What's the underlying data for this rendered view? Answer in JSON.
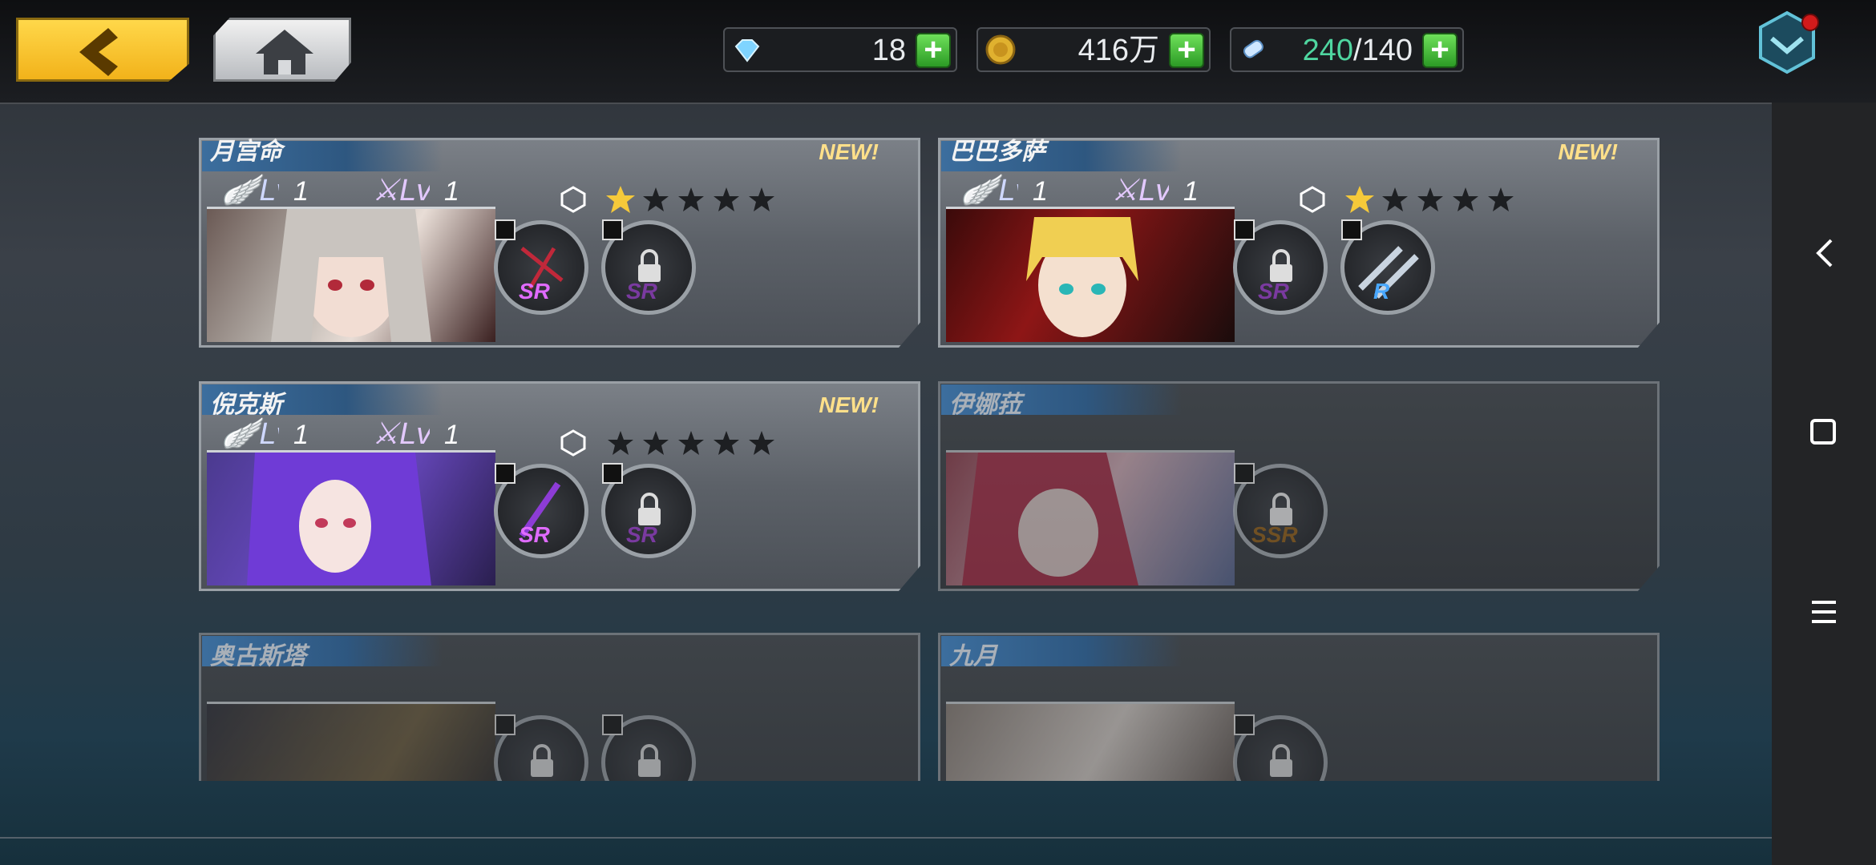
{
  "header": {
    "resources": [
      {
        "name": "diamond",
        "icon": "diamond-icon",
        "value": "18"
      },
      {
        "name": "gold",
        "icon": "gold-coin-icon",
        "value": "416万"
      },
      {
        "name": "stamina",
        "icon": "stamina-potion-icon",
        "current": "240",
        "max_sep": "/140"
      }
    ]
  },
  "side_nav": {
    "back": "‹",
    "home": "□",
    "menu": "≡"
  },
  "new_label": "NEW!",
  "cards": [
    {
      "name": "月宫命",
      "new": true,
      "lv1": "1",
      "lv2": "1",
      "stars": 1,
      "locked": false,
      "weapons": [
        {
          "rarity": "SR",
          "locked": false
        },
        {
          "rarity": "SR",
          "locked": true
        }
      ]
    },
    {
      "name": "巴巴多萨",
      "new": true,
      "lv1": "1",
      "lv2": "1",
      "stars": 1,
      "locked": false,
      "weapons": [
        {
          "rarity": "SR",
          "locked": true
        },
        {
          "rarity": "R",
          "locked": false
        }
      ]
    },
    {
      "name": "倪克斯",
      "new": true,
      "lv1": "1",
      "lv2": "1",
      "stars": 0,
      "locked": false,
      "weapons": [
        {
          "rarity": "SR",
          "locked": false
        },
        {
          "rarity": "SR",
          "locked": true
        }
      ]
    },
    {
      "name": "伊娜菈",
      "new": false,
      "locked": true,
      "weapons": [
        {
          "rarity": "SSR",
          "locked": true
        }
      ]
    },
    {
      "name": "奥古斯塔",
      "new": false,
      "locked": true,
      "weapons": [
        {
          "rarity": "",
          "locked": true
        },
        {
          "rarity": "",
          "locked": true
        }
      ]
    },
    {
      "name": "九月",
      "new": false,
      "locked": true,
      "weapons": [
        {
          "rarity": "",
          "locked": true
        }
      ]
    }
  ],
  "colors": {
    "accent_gold": "#f2b21a",
    "plus_green": "#3cb52f",
    "sr_purple": "#e06bff",
    "r_blue": "#49a8ff"
  }
}
